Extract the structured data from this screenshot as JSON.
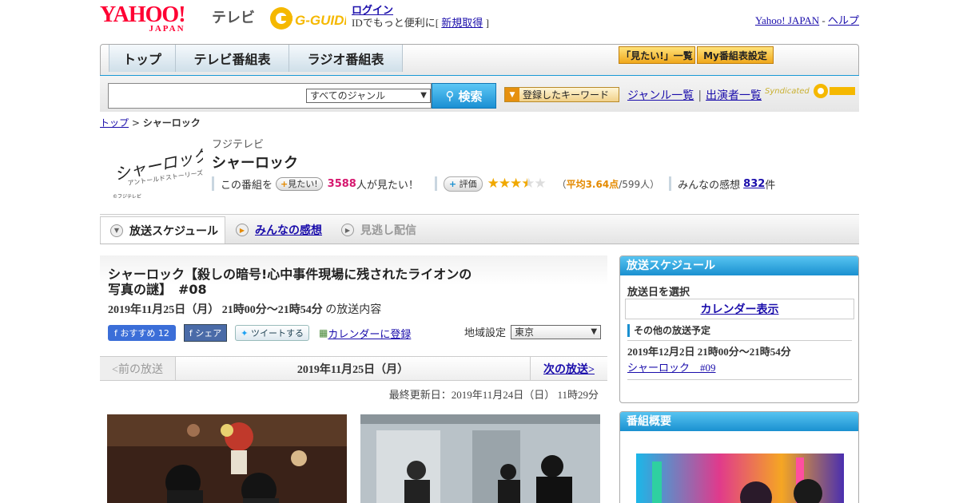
{
  "header": {
    "yahoo_logo": "YAHOO!",
    "yahoo_logo_sub": "JAPAN",
    "tv_label": "テレビ",
    "gguide_logo": "G-GUIDE",
    "login_label": "ログイン",
    "login_text": "IDでもっと便利に[",
    "register_label": "新規取得",
    "login_text_end": "]",
    "yahoo_japan_link": "Yahoo! JAPAN",
    "link_sep": "-",
    "help_link": "ヘルプ"
  },
  "nav": {
    "tabs": [
      {
        "label": "トップ"
      },
      {
        "label": "テレビ番組表"
      },
      {
        "label": "ラジオ番組表"
      }
    ],
    "mitai_list": "「見たい!」一覧",
    "my_schedule": "My番組表設定"
  },
  "search": {
    "query": "",
    "genre_selected": "すべてのジャンル",
    "button": "検索",
    "keyword_button": "登録したキーワード",
    "genre_list": "ジャンル一覧",
    "sep": "|",
    "cast_list": "出演者一覧",
    "syndicated": "Syndicated"
  },
  "breadcrumb": {
    "top": "トップ",
    "sep": ">",
    "current": "シャーロック"
  },
  "program": {
    "logo_text": "シャーロック",
    "logo_sub": "アントールドストーリーズ",
    "logo_copyright": "©フジテレビ",
    "station": "フジテレビ",
    "title": "シャーロック",
    "this_program": "この番組を",
    "mitai_button": "見たい!",
    "mitai_count": "3588",
    "mitai_suffix": "人が見たい！",
    "rating_button": "評価",
    "rating_value": 3.64,
    "avg_prefix": "（",
    "avg_label": "平均3.64点",
    "avg_count": "/599人）",
    "impressions_label": "みんなの感想",
    "impressions_count": "832",
    "impressions_suffix": "件"
  },
  "tabs": {
    "schedule": "放送スケジュール",
    "impressions": "みんなの感想",
    "streaming": "見逃し配信"
  },
  "episode": {
    "title_line1": "シャーロック【殺しの暗号!心中事件現場に残されたライオンの",
    "title_line2": "写真の謎】　#08",
    "date": "2019年11月25日（月）",
    "time": "21時00分～21時54分",
    "date_suffix": "の放送内容",
    "fb_recommend": "おすすめ",
    "fb_count": "12",
    "share": "シェア",
    "tweet": "ツイートする",
    "calendar_register": "カレンダーに登録",
    "region_label": "地域設定",
    "region_selected": "東京",
    "prev": "<前の放送",
    "current_date": "2019年11月25日（月）",
    "next": "次の放送>",
    "updated": "最終更新日：2019年11月24日（日） 11時29分"
  },
  "sidebar": {
    "schedule_head": "放送スケジュール",
    "select_date": "放送日を選択",
    "calendar_button": "カレンダー表示",
    "other_head": "その他の放送予定",
    "other_date": "2019年12月2日 21時00分～21時54分",
    "other_link": "シャーロック　#09",
    "summary_head": "番組概要"
  },
  "colors": {
    "accent_blue": "#1a90d0",
    "yahoo_red": "#ff0033",
    "pink": "#d6186f",
    "orange": "#e48a00"
  }
}
